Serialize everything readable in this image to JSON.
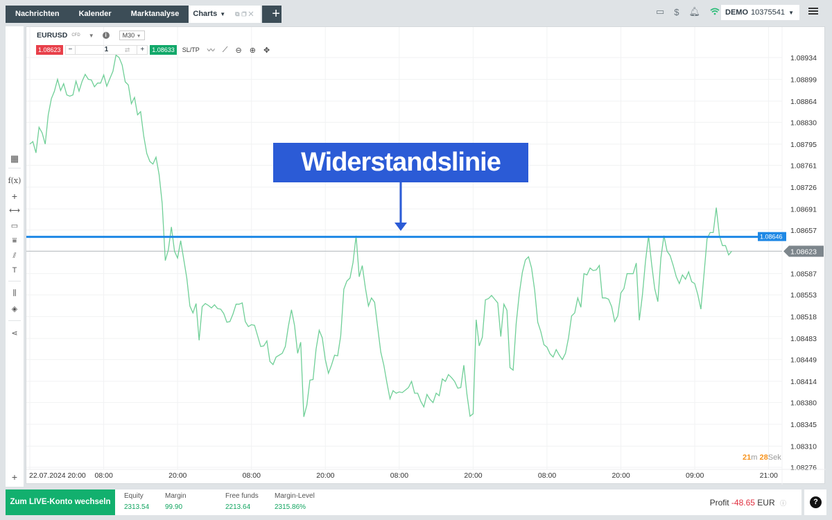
{
  "tabs": [
    {
      "label": "Nachrichten"
    },
    {
      "label": "Kalender"
    },
    {
      "label": "Marktanalyse"
    },
    {
      "label": "Charts"
    }
  ],
  "add_tab_label": "+",
  "account": {
    "mode": "DEMO",
    "number": "10375541"
  },
  "toolbar": {
    "symbol": "EURUSD",
    "symbol_tag": "CFD",
    "timeframe": "M30",
    "sell_price": "1.08623",
    "quantity": "1",
    "buy_price": "1.08633",
    "sltp_label": "SL/TP"
  },
  "annotation": {
    "text": "Widerstandslinie"
  },
  "countdown": {
    "minutes": "21",
    "min_unit": "m",
    "seconds": "28",
    "sec_unit": "Sek"
  },
  "bottom": {
    "live_button": "Zum LIVE-Konto wechseln",
    "stats": [
      {
        "label": "Equity",
        "value": "2313.54"
      },
      {
        "label": "Margin",
        "value": "99.90"
      },
      {
        "label": "Free funds",
        "value": "2213.64"
      },
      {
        "label": "Margin-Level",
        "value": "2315.86%"
      }
    ],
    "profit_label": "Profit",
    "profit_value": "-48.65",
    "profit_currency": "EUR"
  },
  "colors": {
    "line": "#6fcf97",
    "resistance": "#1e88e5",
    "sell": "#e8404a",
    "buy": "#12a86a",
    "annotation": "#2b5bd6"
  },
  "chart_data": {
    "type": "line",
    "title": "EURUSD M30",
    "xlabel": "",
    "ylabel": "",
    "ylim": [
      1.08276,
      1.08934
    ],
    "y_ticks": [
      "1.08934",
      "1.08899",
      "1.08864",
      "1.08830",
      "1.08795",
      "1.08761",
      "1.08726",
      "1.08691",
      "1.08657",
      "1.08623",
      "1.08587",
      "1.08553",
      "1.08518",
      "1.08483",
      "1.08449",
      "1.08414",
      "1.08380",
      "1.08345",
      "1.08310",
      "1.08276"
    ],
    "x_ticks": [
      "22.07.2024 20:00",
      "08:00",
      "20:00",
      "08:00",
      "20:00",
      "08:00",
      "20:00",
      "08:00",
      "20:00",
      "09:00",
      "21:00"
    ],
    "x_tick_bar_index": [
      0,
      24,
      48,
      72,
      96,
      120,
      144,
      168,
      192,
      216,
      240
    ],
    "grid": true,
    "resistance_line": {
      "label": "Widerstandslinie",
      "value": 1.08646
    },
    "current_price": 1.08623,
    "series": [
      {
        "name": "EURUSD",
        "values": [
          1.08795,
          1.08799,
          1.08781,
          1.08822,
          1.08813,
          1.08795,
          1.08842,
          1.08868,
          1.0888,
          1.08899,
          1.08881,
          1.08892,
          1.08874,
          1.08872,
          1.08874,
          1.08896,
          1.0888,
          1.08896,
          1.08907,
          1.08899,
          1.08898,
          1.08887,
          1.08893,
          1.08893,
          1.08906,
          1.08888,
          1.089,
          1.08912,
          1.08938,
          1.08934,
          1.08922,
          1.08895,
          1.0889,
          1.0886,
          1.0887,
          1.08842,
          1.08847,
          1.08808,
          1.0878,
          1.08767,
          1.08763,
          1.08774,
          1.08746,
          1.087,
          1.08608,
          1.08625,
          1.08662,
          1.08623,
          1.08612,
          1.0864,
          1.0861,
          1.0858,
          1.08535,
          1.08524,
          1.08539,
          1.0848,
          1.08534,
          1.08539,
          1.08536,
          1.08532,
          1.08537,
          1.08531,
          1.0853,
          1.08523,
          1.08509,
          1.0851,
          1.08522,
          1.08538,
          1.08538,
          1.0854,
          1.0851,
          1.08502,
          1.08505,
          1.08504,
          1.08487,
          1.0847,
          1.08471,
          1.08479,
          1.08446,
          1.08441,
          1.08453,
          1.08456,
          1.08459,
          1.0847,
          1.08503,
          1.08529,
          1.08504,
          1.08459,
          1.08477,
          1.08357,
          1.08376,
          1.08416,
          1.08417,
          1.08466,
          1.08496,
          1.08484,
          1.08449,
          1.08427,
          1.0844,
          1.08456,
          1.08455,
          1.08487,
          1.08562,
          1.08575,
          1.0858,
          1.08605,
          1.08648,
          1.08582,
          1.086,
          1.08564,
          1.08535,
          1.08548,
          1.08541,
          1.08501,
          1.08461,
          1.0844,
          1.08412,
          1.08386,
          1.08399,
          1.08395,
          1.08397,
          1.08396,
          1.084,
          1.08404,
          1.08414,
          1.08395,
          1.08395,
          1.08382,
          1.08373,
          1.08393,
          1.08385,
          1.0838,
          1.08395,
          1.08391,
          1.08418,
          1.08414,
          1.08425,
          1.0842,
          1.08414,
          1.08403,
          1.08404,
          1.0844,
          1.08393,
          1.08358,
          1.08362,
          1.08513,
          1.08471,
          1.08485,
          1.08545,
          1.08547,
          1.08552,
          1.08546,
          1.0854,
          1.08486,
          1.08538,
          1.08528,
          1.08436,
          1.08432,
          1.08507,
          1.08555,
          1.08589,
          1.08609,
          1.08614,
          1.08596,
          1.0856,
          1.08509,
          1.08494,
          1.08473,
          1.08469,
          1.08458,
          1.08453,
          1.08465,
          1.08456,
          1.08449,
          1.08459,
          1.08484,
          1.08519,
          1.08524,
          1.08548,
          1.08533,
          1.08587,
          1.08585,
          1.08596,
          1.08592,
          1.08593,
          1.086,
          1.08548,
          1.08548,
          1.08546,
          1.08534,
          1.0851,
          1.08519,
          1.08556,
          1.08563,
          1.08587,
          1.08587,
          1.08587,
          1.08604,
          1.08512,
          1.08553,
          1.08607,
          1.08648,
          1.08602,
          1.08563,
          1.08542,
          1.08612,
          1.08648,
          1.08623,
          1.08616,
          1.086,
          1.08582,
          1.08571,
          1.08585,
          1.08578,
          1.0859,
          1.08574,
          1.08571,
          1.08553,
          1.0853,
          1.08586,
          1.08643,
          1.08653,
          1.08653,
          1.08693,
          1.08648,
          1.08632,
          1.08632,
          1.08617,
          1.08623
        ]
      }
    ]
  }
}
